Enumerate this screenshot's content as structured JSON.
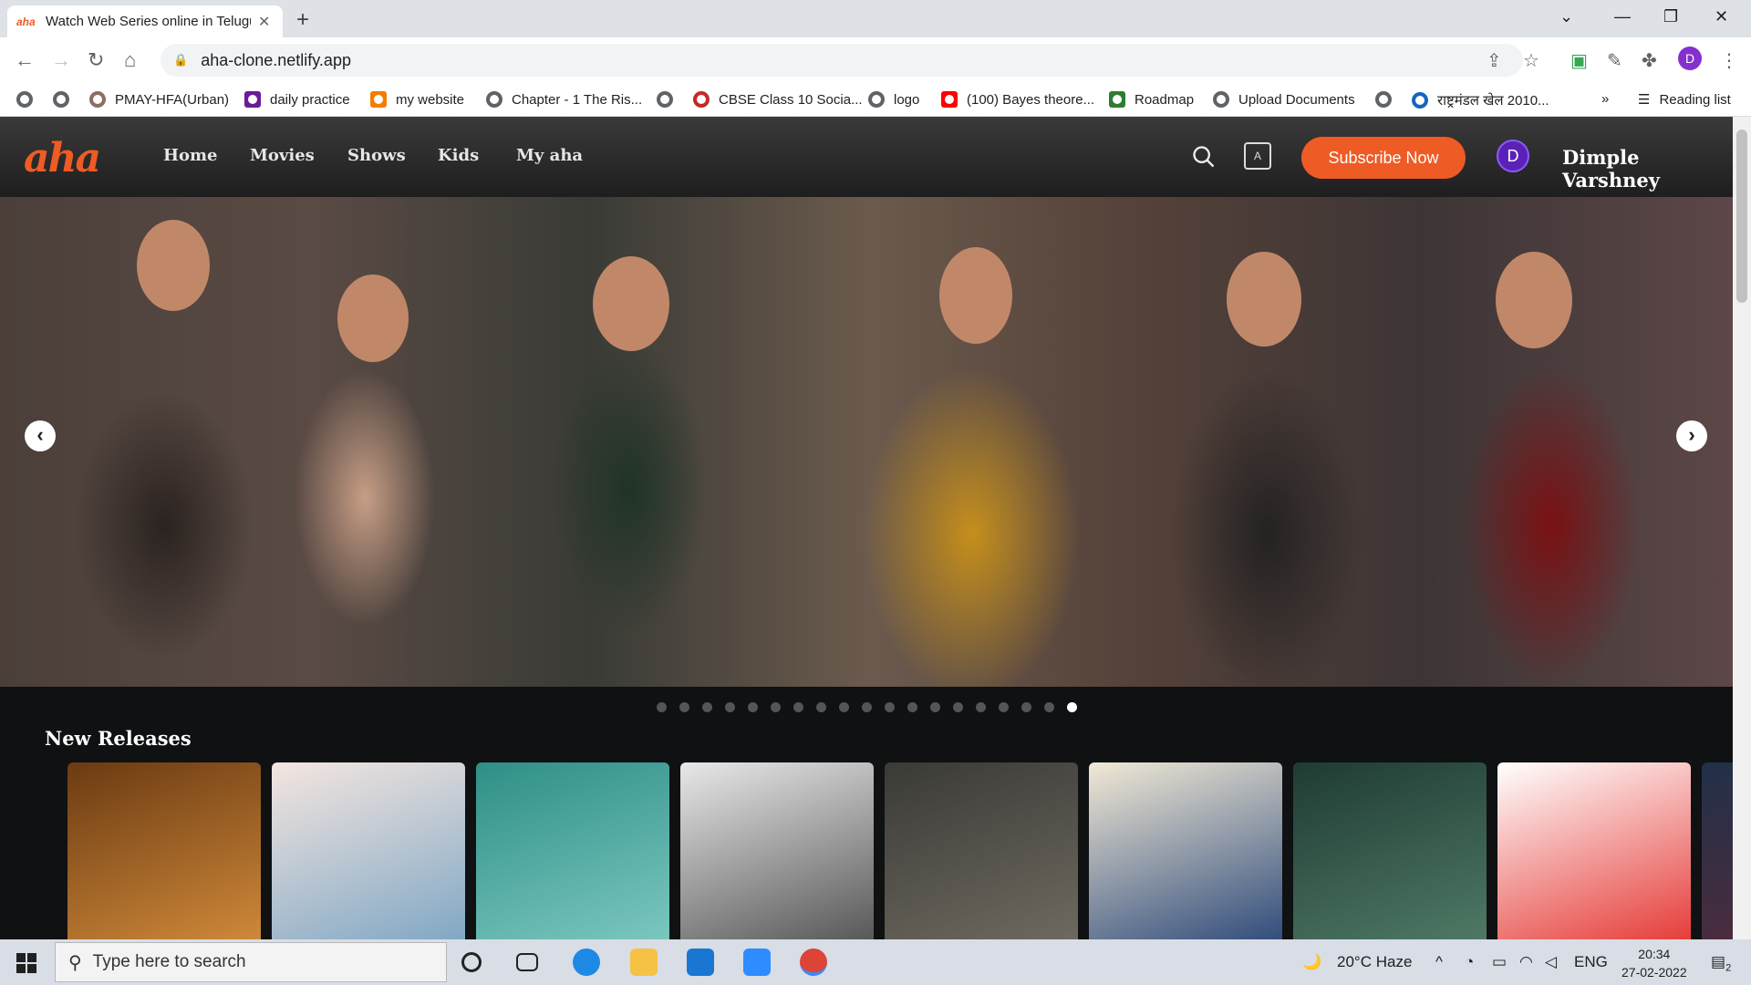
{
  "browser": {
    "tab_title": "Watch Web Series online in Telugu",
    "tab_favicon": "aha",
    "url": "aha-clone.netlify.app",
    "profile_initial": "D"
  },
  "bookmarks": [
    {
      "label": ""
    },
    {
      "label": ""
    },
    {
      "label": "PMAY-HFA(Urban)"
    },
    {
      "label": "daily practice"
    },
    {
      "label": "my website"
    },
    {
      "label": "Chapter - 1 The Ris..."
    },
    {
      "label": ""
    },
    {
      "label": "CBSE Class 10 Socia..."
    },
    {
      "label": "logo"
    },
    {
      "label": "(100) Bayes theore..."
    },
    {
      "label": "Roadmap"
    },
    {
      "label": "Upload Documents"
    },
    {
      "label": ""
    },
    {
      "label": "राष्ट्रमंडल खेल 2010..."
    }
  ],
  "bookmarks_more": "»",
  "reading_list": "Reading list",
  "site": {
    "logo": "aha",
    "nav": [
      "Home",
      "Movies",
      "Shows",
      "Kids",
      "My aha"
    ],
    "subscribe_label": "Subscribe Now",
    "avatar_initial": "D",
    "username": "Dimple Varshney",
    "accent": "#ef5b25"
  },
  "carousel": {
    "slide_count": 19,
    "active_index": 18
  },
  "section": {
    "title": "New Releases",
    "card_count": 9
  },
  "taskbar": {
    "search_placeholder": "Type here to search",
    "weather": "20°C  Haze",
    "language": "ENG",
    "time": "20:34",
    "date": "27-02-2022",
    "notifications": "2"
  }
}
